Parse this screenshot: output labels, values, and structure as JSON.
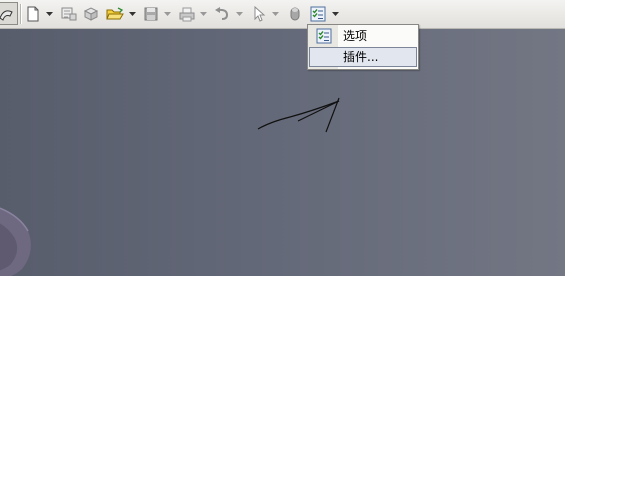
{
  "toolbar": {
    "icons": [
      "rebuild-icon",
      "new-document-icon",
      "dropdown-arrow-icon",
      "make-drawing-icon",
      "make-assembly-icon",
      "open-folder-icon",
      "save-icon",
      "print-icon",
      "undo-icon",
      "select-pointer-icon",
      "cylinder-icon",
      "options-icon"
    ]
  },
  "options_menu": {
    "items": [
      {
        "label": "选项",
        "icon": "options-checklist-icon"
      },
      {
        "label": "插件...",
        "icon": ""
      }
    ]
  },
  "colors": {
    "viewport_left": "#585d6c",
    "viewport_right": "#737784",
    "toolbar_bg": "#e8e6e2",
    "menu_bg": "#fbfbfa"
  }
}
